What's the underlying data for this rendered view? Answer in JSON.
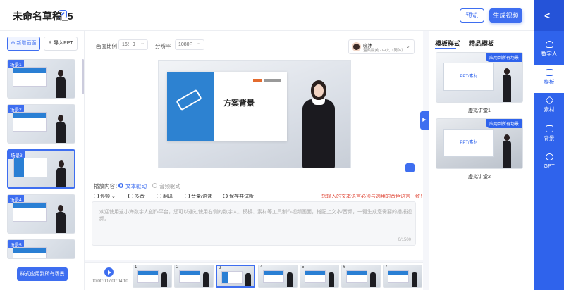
{
  "header": {
    "title": "未命名草稿_5",
    "preview": "预览",
    "generate": "生成视频"
  },
  "rail": {
    "items": [
      {
        "label": "数字人"
      },
      {
        "label": "模板"
      },
      {
        "label": "素材"
      },
      {
        "label": "背景"
      },
      {
        "label": "GPT"
      }
    ],
    "active": "模板"
  },
  "left": {
    "add_scene": "新增画面",
    "import_ppt": "导入PPT",
    "scenes": [
      {
        "label": "场景1"
      },
      {
        "label": "场景2"
      },
      {
        "label": "场景3"
      },
      {
        "label": "场景4"
      },
      {
        "label": "场景5"
      }
    ],
    "selected_scene": "场景3",
    "apply_all": "样式应用到所有场景"
  },
  "controls": {
    "ratio_label": "画面比例",
    "ratio_value": "16：9",
    "resolution_label": "分辨率",
    "resolution_value": "1080P"
  },
  "avatar": {
    "name": "晓沐",
    "sub": "温柔甜美 · 中文（简体）"
  },
  "canvas": {
    "slide_title": "方案背景"
  },
  "play_mode": {
    "label": "播放内容：",
    "text_driven": "文本驱动",
    "audio_driven": "音频驱动",
    "selected": "文本驱动"
  },
  "toolbar": {
    "pause": "停顿",
    "polyphone": "多音",
    "translate": "翻译",
    "volume_speed": "音量/语速",
    "save_test": "保存并试听",
    "warning": "您输入的文本语言必须与选用的音色语言一致！"
  },
  "script": {
    "placeholder": "欢迎使用这小海数字人创作平台，您可以通过使用右侧的数字人、模板、素材等工具制作视频画面，搭配上文本/音频，一键生成您需要的播报视频。",
    "counter": "0/1500"
  },
  "timeline": {
    "time": "00:00:00 / 00:04:10",
    "clips": [
      "1",
      "2",
      "3",
      "4",
      "5",
      "6",
      "7"
    ],
    "selected_clip": "3"
  },
  "templates": {
    "tab_template": "模板样式",
    "tab_premium": "精品模板",
    "cards": [
      {
        "badge": "应用到所有场景",
        "text": "PPT/素材",
        "caption": "虚拟讲堂1"
      },
      {
        "badge": "应用到所有场景",
        "text": "PPT/素材",
        "caption": "虚拟讲堂2"
      }
    ]
  },
  "colors": {
    "accent": "#3e6ef0",
    "rail": "#2f63ec",
    "warning": "#e04a3a"
  }
}
